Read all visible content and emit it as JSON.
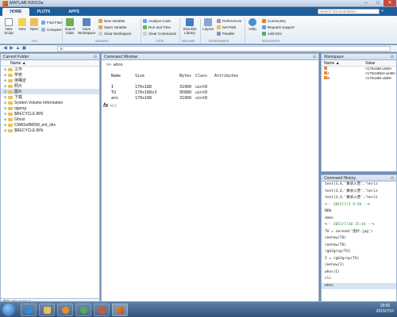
{
  "window": {
    "title": "MATLAB R2013a",
    "min": "–",
    "max": "□",
    "close": "✕"
  },
  "ribbon_tabs": [
    "HOME",
    "PLOTS",
    "APPS"
  ],
  "search_placeholder": "Search Documentation",
  "toolstrip": {
    "new_script": "New Script",
    "new": "New",
    "open": "Open",
    "find_files": "Find Files",
    "compare": "Compare",
    "import_data": "Import Data",
    "save_workspace": "Save Workspace",
    "new_variable": "New Variable",
    "open_variable": "Open Variable",
    "clear_workspace": "Clear Workspace",
    "analyze_code": "Analyze Code",
    "run_and_time": "Run and Time",
    "clear_commands": "Clear Commands",
    "simulink_library": "Simulink Library",
    "layout": "Layout",
    "preferences": "Preferences",
    "set_path": "Set Path",
    "parallel": "Parallel",
    "help": "Help",
    "community": "Community",
    "request_support": "Request Support",
    "add_ons": "Add-Ons",
    "sec_file": "FILE",
    "sec_variable": "VARIABLE",
    "sec_code": "CODE",
    "sec_simulink": "SIMULINK",
    "sec_environment": "ENVIRONMENT",
    "sec_resources": "RESOURCES"
  },
  "address": {
    "path": "E:"
  },
  "current_folder": {
    "title": "Current Folder",
    "col_name": "Name ▲",
    "items": [
      "工作",
      "学校",
      "待确定",
      "照片",
      "图片",
      "下载",
      "System Volume Information",
      "qigong",
      "$RECYCLE.BIN",
      "Ghost",
      "CMASoftMSM_ent_sbx",
      "$RECYCLE.BIN"
    ],
    "footer": "图片 (File Folder)"
  },
  "command_window": {
    "title": "Command Window",
    "cmd": ">> whos",
    "headers": [
      "Name",
      "Size",
      "Bytes",
      "Class",
      "Attributes"
    ],
    "rows": [
      [
        "I",
        "170x188",
        "31960",
        "uint8",
        ""
      ],
      [
        "TU",
        "170x188x3",
        "95880",
        "uint8",
        ""
      ],
      [
        "ans",
        "170x188",
        "31960",
        "uint8",
        ""
      ]
    ],
    "prompt": "fx",
    "prompt_arrows": ">> |"
  },
  "workspace": {
    "title": "Workspace",
    "col_name": "Name ▲",
    "col_value": "Value",
    "rows": [
      {
        "name": "I",
        "value": "<170x188 uint8>"
      },
      {
        "name": "TU",
        "value": "<170x188x3 uint8>"
      },
      {
        "name": "ans",
        "value": "<170x188 uint8>"
      }
    ]
  },
  "command_history": {
    "title": "Command History",
    "rows": [
      "text(3,4,'乘承入营','horiz",
      "text(3,4,'乘承入营','horiz",
      "text(3,4,'乘承入营','horiz",
      "%-- 2015/7/3 9:38 --%",
      "NEW",
      "demo",
      "%-- 2015/7/10 15:44 --%",
      "TU = imread('图片.jpg')",
      "imshow(TU)",
      "imshow(TU)",
      "rgb2gray(TU)",
      "I = rgb2gray(TU)",
      "imshow(I)",
      "whos(I)",
      "clc",
      "whos"
    ]
  },
  "taskbar": {
    "time": "18:06",
    "date": "2015/7/10"
  }
}
